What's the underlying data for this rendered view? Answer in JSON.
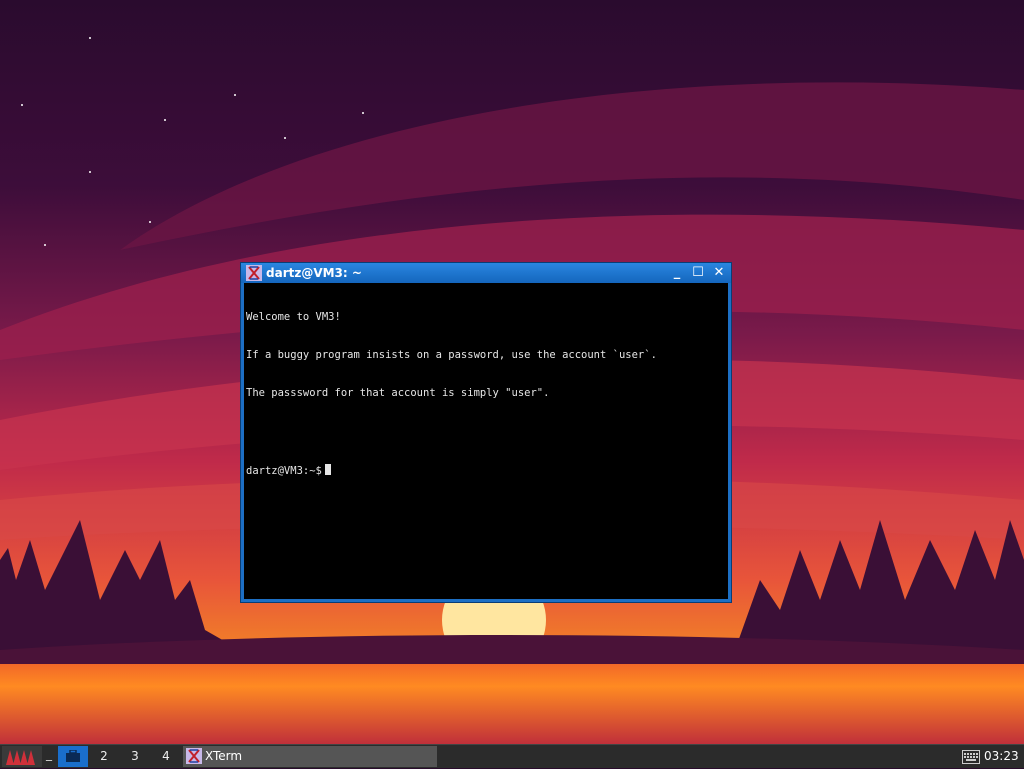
{
  "window": {
    "title": "dartz@VM3: ~",
    "minimize_glyph": "_",
    "maximize_glyph": "☐",
    "close_glyph": "✕",
    "app_icon": "xterm-icon"
  },
  "terminal": {
    "lines": [
      "Welcome to VM3!",
      "If a buggy program insists on a password, use the account `user`.",
      "The passsword for that account is simply \"user\".",
      ""
    ],
    "prompt": "dartz@VM3:~$"
  },
  "taskbar": {
    "start_icon": "start-menu-icon",
    "separator": "_",
    "workspaces": [
      {
        "label": "",
        "icon": "briefcase-icon",
        "active": true
      },
      {
        "label": "2"
      },
      {
        "label": "3"
      },
      {
        "label": "4"
      }
    ],
    "tasks": [
      {
        "label": "XTerm",
        "icon": "xterm-icon"
      }
    ],
    "keyboard_icon": "keyboard-icon",
    "clock": "03:23"
  },
  "colors": {
    "title_bar": "#1d6fc4",
    "terminal_bg": "#000000",
    "terminal_fg": "#e6e6e6",
    "taskbar_bg": "#2b2b2b",
    "active_workspace": "#1a6ecc"
  }
}
